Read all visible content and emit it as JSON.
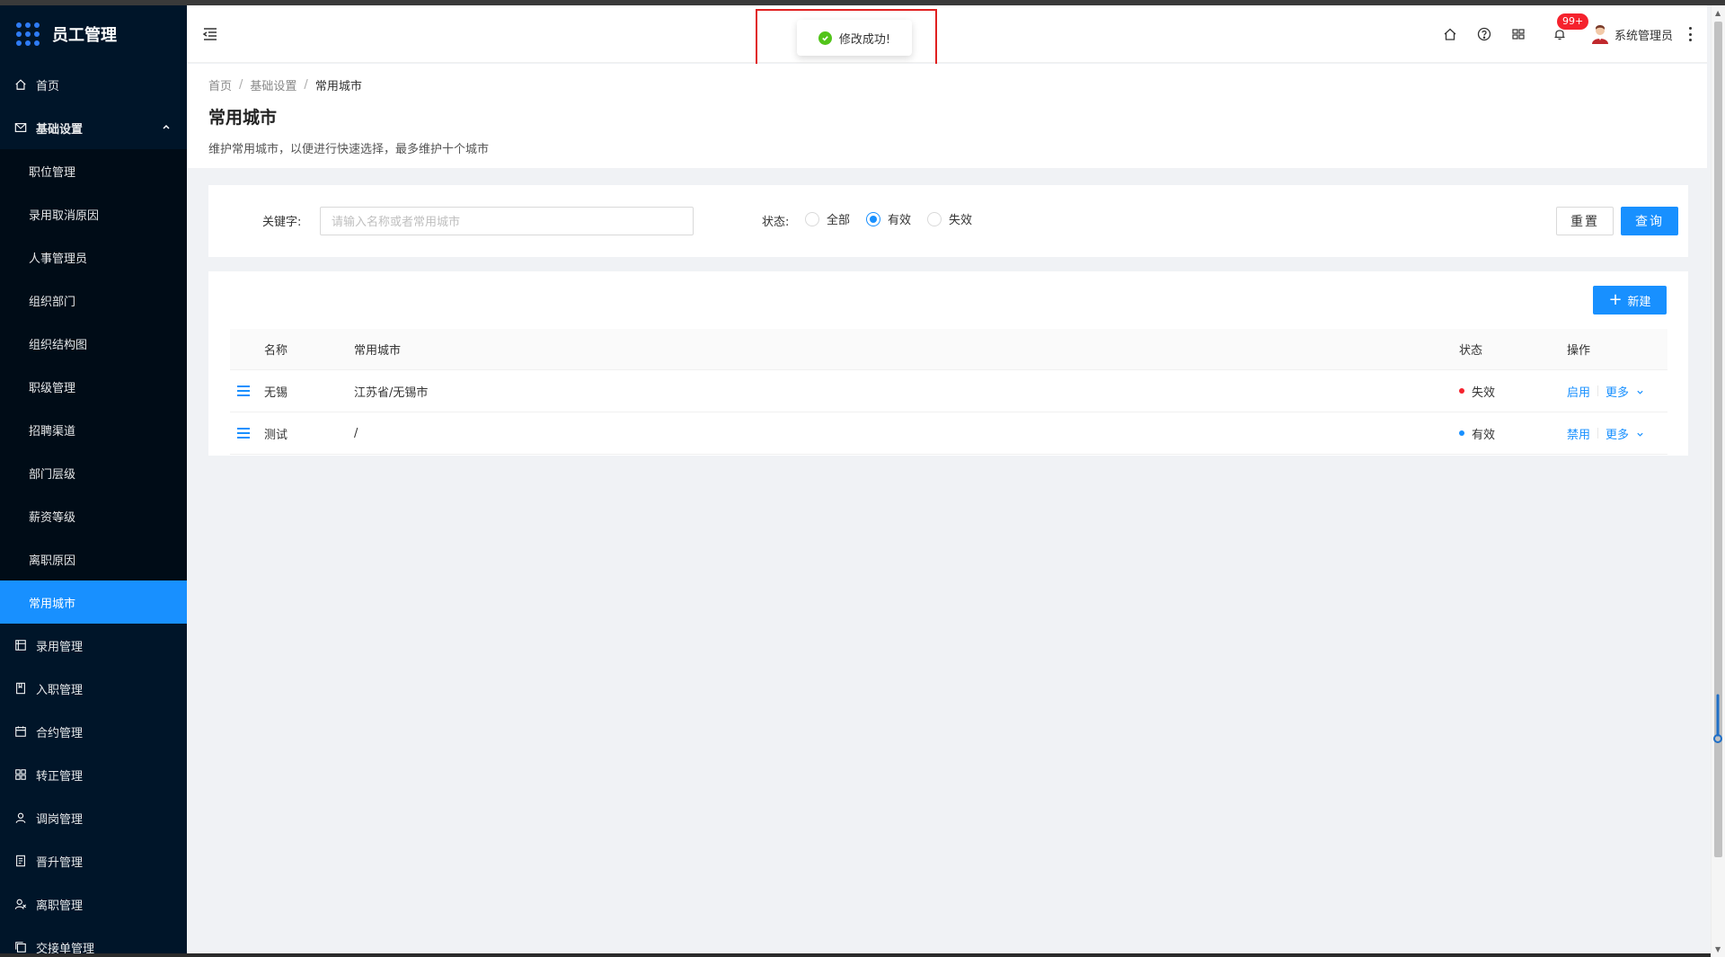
{
  "app": {
    "title": "员工管理"
  },
  "sidebar": {
    "items": [
      {
        "label": "首页",
        "icon": "home-icon"
      },
      {
        "label": "基础设置",
        "icon": "mail-icon",
        "open": true
      }
    ],
    "submenu": [
      {
        "label": "职位管理"
      },
      {
        "label": "录用取消原因"
      },
      {
        "label": "人事管理员"
      },
      {
        "label": "组织部门"
      },
      {
        "label": "组织结构图"
      },
      {
        "label": "职级管理"
      },
      {
        "label": "招聘渠道"
      },
      {
        "label": "部门层级"
      },
      {
        "label": "薪资等级"
      },
      {
        "label": "离职原因"
      },
      {
        "label": "常用城市",
        "active": true
      }
    ],
    "bottom_items": [
      {
        "label": "录用管理",
        "icon": "form-icon"
      },
      {
        "label": "入职管理",
        "icon": "book-icon"
      },
      {
        "label": "合约管理",
        "icon": "calendar-icon"
      },
      {
        "label": "转正管理",
        "icon": "grid-icon"
      },
      {
        "label": "调岗管理",
        "icon": "user-icon"
      },
      {
        "label": "晋升管理",
        "icon": "file-icon"
      },
      {
        "label": "离职管理",
        "icon": "user-remove-icon"
      },
      {
        "label": "交接单管理",
        "icon": "copy-icon"
      }
    ]
  },
  "header": {
    "badge": "99+",
    "user_name": "系统管理员"
  },
  "toast": {
    "message": "修改成功!"
  },
  "page": {
    "breadcrumb": [
      "首页",
      "基础设置",
      "常用城市"
    ],
    "title": "常用城市",
    "description": "维护常用城市，以便进行快速选择，最多维护十个城市"
  },
  "filter": {
    "keyword_label": "关键字:",
    "keyword_placeholder": "请输入名称或者常用城市",
    "keyword_value": "",
    "status_label": "状态:",
    "status_options": [
      "全部",
      "有效",
      "失效"
    ],
    "status_selected": "有效",
    "reset_label": "重置",
    "query_label": "查询"
  },
  "table": {
    "new_label": "新建",
    "columns": [
      "名称",
      "常用城市",
      "状态",
      "操作"
    ],
    "rows": [
      {
        "name": "无锡",
        "city": "江苏省/无锡市",
        "status": "失效",
        "status_color": "#f5222d",
        "action": "启用",
        "more": "更多"
      },
      {
        "name": "测试",
        "city": "/",
        "status": "有效",
        "status_color": "#1890ff",
        "action": "禁用",
        "more": "更多"
      }
    ]
  },
  "colors": {
    "primary": "#1890ff",
    "sidebar_bg": "#001529",
    "success": "#52c41a",
    "danger": "#f5222d"
  }
}
